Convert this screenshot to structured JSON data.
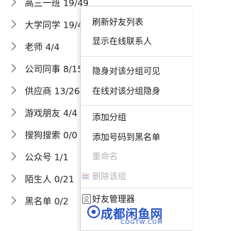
{
  "groups": [
    {
      "name": "高三一班 19/49"
    },
    {
      "name": "大学同学 19/49"
    },
    {
      "name": "老师 4/4"
    },
    {
      "name": "公司同事 8/15"
    },
    {
      "name": "供应商 13/26"
    },
    {
      "name": "游戏朋友 4/4"
    },
    {
      "name": "搜狗搜索 0/0"
    },
    {
      "name": "公众号 1/1"
    },
    {
      "name": "陌生人 0/21"
    },
    {
      "name": "黑名单 0/2"
    }
  ],
  "context_menu": {
    "refresh_friend_list": "刷新好友列表",
    "show_online_contacts": "显示在线联系人",
    "invisible_to_group": "隐身对该分组可见",
    "online_hidden_to_group": "在线对该分组隐身",
    "add_group": "添加分组",
    "add_number_to_blacklist": "添加号码到黑名单",
    "rename": "重命名",
    "delete_group": "删除该组",
    "friend_manager": "好友管理器"
  },
  "watermark": {
    "text": "成都闲鱼网",
    "sub": "CDGTW.COM"
  },
  "colors": {
    "disabled_text": "#b4b4b4",
    "watermark_blue": "#2b55c6"
  },
  "icons": {
    "collapsed_group": "chevron-right-icon",
    "delete_group": "delete-group-icon",
    "friend_manager": "contact-card-icon"
  }
}
